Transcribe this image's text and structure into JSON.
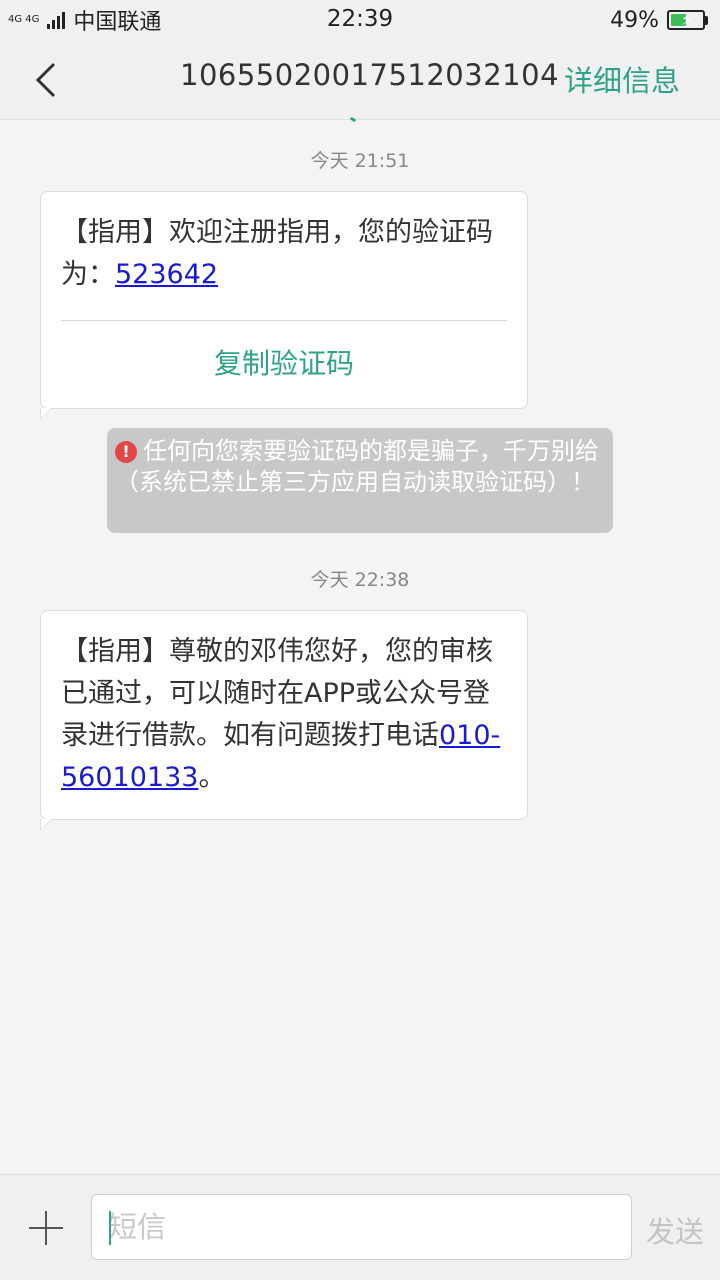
{
  "status_bar": {
    "net_label_top": "4G 4G",
    "carrier": "中国联通",
    "time": "22:39",
    "battery_percent": "49%",
    "battery_level": 0.49
  },
  "header": {
    "contact": "106550200175120321​04",
    "details_label": "详细信息"
  },
  "messages": [
    {
      "timestamp": "今天  21:51",
      "text_before": "【指用】欢迎注册指用，您的验证码为：",
      "link_text": "523642",
      "text_after": "",
      "action_label": "复制验证码"
    },
    {
      "timestamp": "今天  22:38",
      "text_before": "【指用】尊敬的邓伟您好，您的审核已通过，可以随时在APP或公众号登录进行借款。如有问题拨打电话",
      "link_text": "010-56010133",
      "text_after": "。"
    }
  ],
  "warning": {
    "icon": "!",
    "text": "任何向您索要验证码的都是骗子，千万别给（系统已禁止第三方应用自动读取验证码）！"
  },
  "input_bar": {
    "placeholder": "短信",
    "send_label": "发送"
  },
  "colors": {
    "accent": "#2fa38a",
    "link": "#1a1ad6",
    "warning_bg": "#c8c8c8",
    "warning_icon": "#e14747"
  }
}
